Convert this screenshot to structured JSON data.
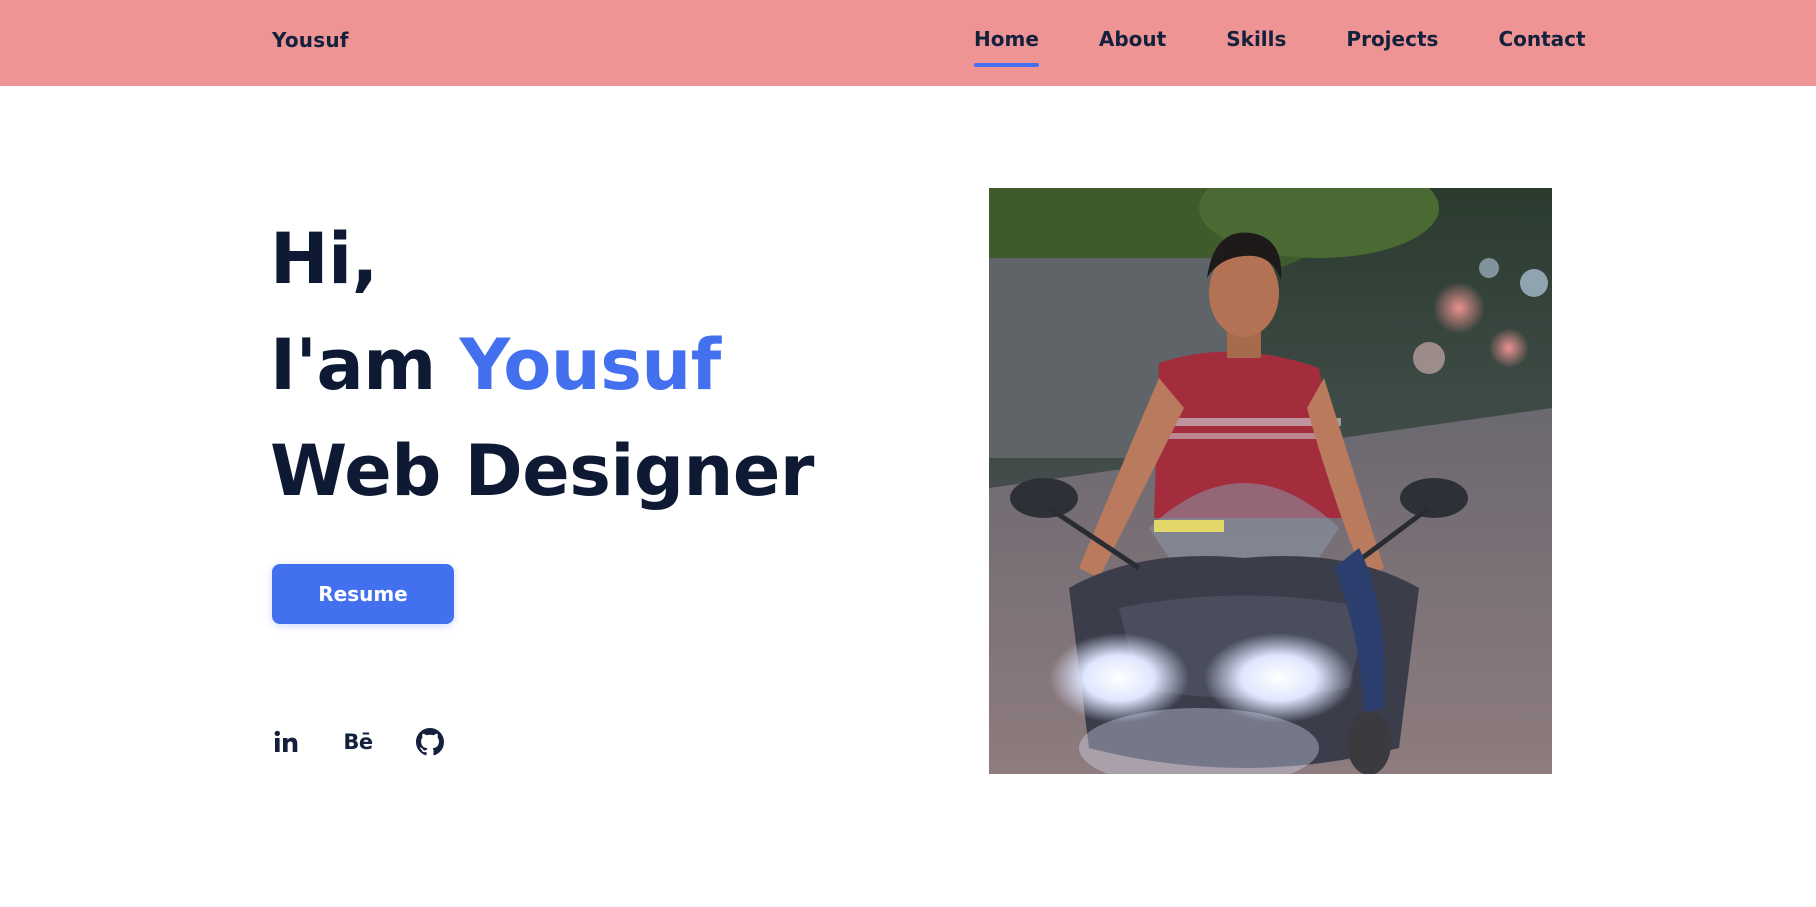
{
  "header": {
    "brand": "Yousuf",
    "nav": [
      {
        "label": "Home",
        "active": true
      },
      {
        "label": "About",
        "active": false
      },
      {
        "label": "Skills",
        "active": false
      },
      {
        "label": "Projects",
        "active": false
      },
      {
        "label": "Contact",
        "active": false
      }
    ]
  },
  "hero": {
    "greeting": "Hi,",
    "intro_prefix": "I'am",
    "name": "Yousuf",
    "role": "Web Designer",
    "resume_label": "Resume"
  },
  "social": {
    "behance_text": "Bē",
    "links": [
      "linkedin-icon",
      "behance-icon",
      "github-icon"
    ]
  },
  "colors": {
    "header_bg": "#ee9494",
    "accent": "#4270ee",
    "text_dark": "#0e1a33"
  }
}
